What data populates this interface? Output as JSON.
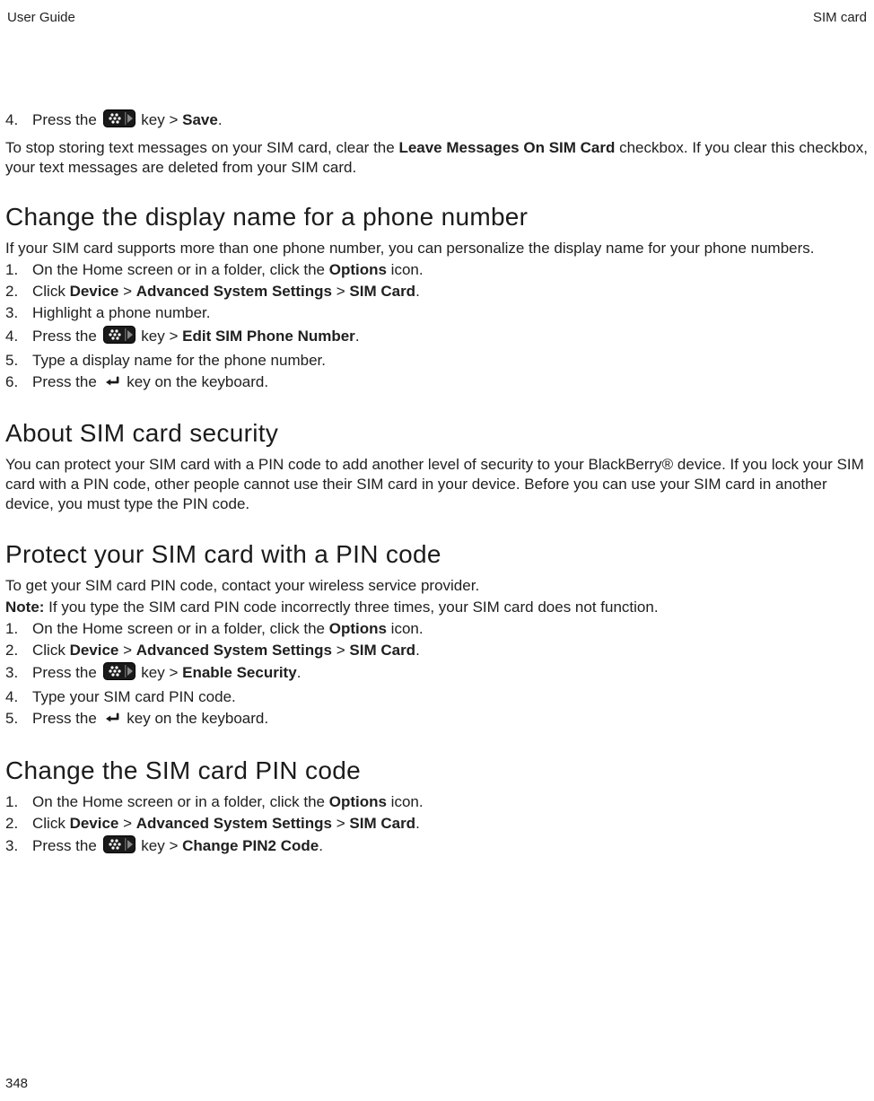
{
  "header": {
    "left": "User Guide",
    "right": "SIM card"
  },
  "footer": {
    "page": "348"
  },
  "step4top": {
    "num": "4.",
    "preIcon": "Press the ",
    "postIcon": " key > ",
    "bold": "Save",
    "tail": "."
  },
  "paraAfter4": {
    "t1": "To stop storing text messages on your SIM card, clear the ",
    "b1": "Leave Messages On SIM Card",
    "t2": " checkbox. If you clear this checkbox, your text messages are deleted from your SIM card."
  },
  "sec1": {
    "title": "Change the display name for a phone number",
    "intro": "If your SIM card supports more than one phone number, you can personalize the display name for your phone numbers.",
    "s1": {
      "num": "1.",
      "t1": "On the Home screen or in a folder, click the ",
      "b1": "Options",
      "t2": " icon."
    },
    "s2": {
      "num": "2.",
      "t1": "Click ",
      "b1": "Device",
      "t2": " > ",
      "b2": "Advanced System Settings",
      "t3": " > ",
      "b3": "SIM Card",
      "t4": "."
    },
    "s3": {
      "num": "3.",
      "t1": "Highlight a phone number."
    },
    "s4": {
      "num": "4.",
      "t1": "Press the ",
      "t2": " key > ",
      "b1": "Edit SIM Phone Number",
      "t3": "."
    },
    "s5": {
      "num": "5.",
      "t1": "Type a display name for the phone number."
    },
    "s6": {
      "num": "6.",
      "t1": "Press the ",
      "t2": " key on the keyboard."
    }
  },
  "sec2": {
    "title": "About SIM card security",
    "p": "You can protect your SIM card with a PIN code to add another level of security to your BlackBerry® device. If you lock your SIM card with a PIN code, other people cannot use their SIM card in your device. Before you can use your SIM card in another device, you must type the PIN code."
  },
  "sec3": {
    "title": "Protect your SIM card with a PIN code",
    "p1": "To get your SIM card PIN code, contact your wireless service provider.",
    "noteLabel": "Note:",
    "noteText": " If you type the SIM card PIN code incorrectly three times, your SIM card does not function.",
    "s1": {
      "num": "1.",
      "t1": "On the Home screen or in a folder, click the ",
      "b1": "Options",
      "t2": " icon."
    },
    "s2": {
      "num": "2.",
      "t1": "Click ",
      "b1": "Device",
      "t2": " > ",
      "b2": "Advanced System Settings",
      "t3": " > ",
      "b3": "SIM Card",
      "t4": "."
    },
    "s3": {
      "num": "3.",
      "t1": "Press the ",
      "t2": " key > ",
      "b1": "Enable Security",
      "t3": "."
    },
    "s4": {
      "num": "4.",
      "t1": "Type your SIM card PIN code."
    },
    "s5": {
      "num": "5.",
      "t1": "Press the ",
      "t2": " key on the keyboard."
    }
  },
  "sec4": {
    "title": "Change the SIM card PIN code",
    "s1": {
      "num": "1.",
      "t1": "On the Home screen or in a folder, click the ",
      "b1": "Options",
      "t2": " icon."
    },
    "s2": {
      "num": "2.",
      "t1": "Click ",
      "b1": "Device",
      "t2": " > ",
      "b2": "Advanced System Settings",
      "t3": " > ",
      "b3": "SIM Card",
      "t4": "."
    },
    "s3": {
      "num": "3.",
      "t1": "Press the ",
      "t2": " key > ",
      "b1": "Change PIN2 Code",
      "t3": "."
    }
  }
}
